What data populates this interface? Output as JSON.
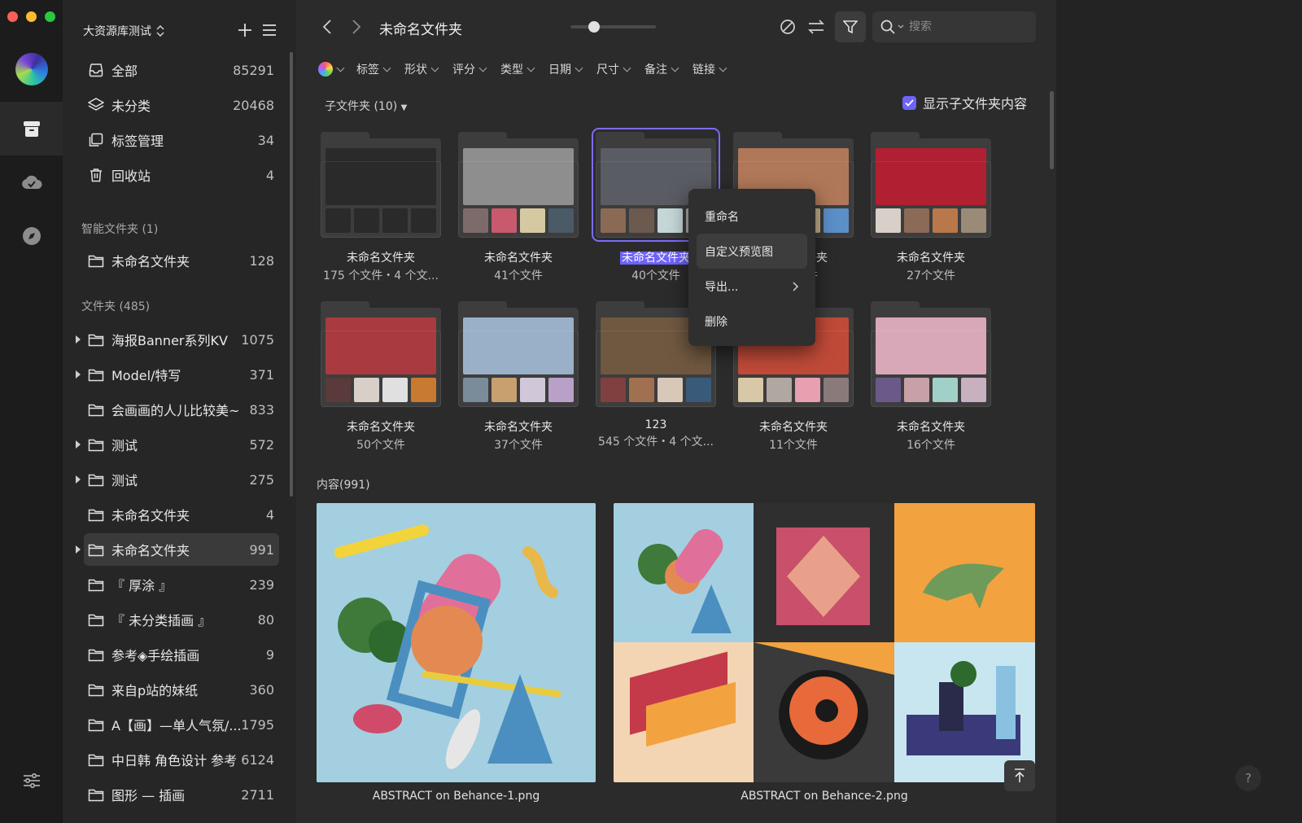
{
  "window": {
    "traffic_colors": [
      "#ff5f57",
      "#febc2e",
      "#28c840"
    ]
  },
  "library": {
    "name": "大资源库测试"
  },
  "sidebar": {
    "top_items": [
      {
        "label": "全部",
        "count": "85291",
        "icon": "inbox-icon"
      },
      {
        "label": "未分类",
        "count": "20468",
        "icon": "layers-icon"
      },
      {
        "label": "标签管理",
        "count": "34",
        "icon": "tag-manage-icon"
      },
      {
        "label": "回收站",
        "count": "4",
        "icon": "trash-icon"
      }
    ],
    "smart_title": "智能文件夹 (1)",
    "smart_items": [
      {
        "label": "未命名文件夹",
        "count": "128"
      }
    ],
    "folders_title": "文件夹 (485)",
    "folders": [
      {
        "label": "海报Banner系列KV",
        "count": "1075",
        "expandable": true
      },
      {
        "label": "Model/特写",
        "count": "371",
        "expandable": true
      },
      {
        "label": "会画画的人儿比较美~",
        "count": "833",
        "expandable": false
      },
      {
        "label": "测试",
        "count": "572",
        "expandable": true
      },
      {
        "label": "测试",
        "count": "275",
        "expandable": true
      },
      {
        "label": "未命名文件夹",
        "count": "4",
        "expandable": false
      },
      {
        "label": "未命名文件夹",
        "count": "991",
        "expandable": true,
        "selected": true
      },
      {
        "label": "『 厚涂 』",
        "count": "239",
        "expandable": false
      },
      {
        "label": "『 未分类插画 』",
        "count": "80",
        "expandable": false
      },
      {
        "label": "参考◈手绘插画",
        "count": "9",
        "expandable": false
      },
      {
        "label": "来自p站的妹纸",
        "count": "360",
        "expandable": false
      },
      {
        "label": "A【画】—单人气氛/...",
        "count": "1795",
        "expandable": false
      },
      {
        "label": "中日韩 角色设计 参考",
        "count": "6124",
        "expandable": false
      },
      {
        "label": "图形 — 插画",
        "count": "2711",
        "expandable": false
      }
    ]
  },
  "toolbar": {
    "title": "未命名文件夹",
    "zoom_percent": 28,
    "search_placeholder": "搜索"
  },
  "filters": [
    "标签",
    "形状",
    "评分",
    "类型",
    "日期",
    "尺寸",
    "备注",
    "链接"
  ],
  "subfolders": {
    "label": "子文件夹 (10)",
    "show_sub_label": "显示子文件夹内容",
    "items": [
      {
        "name": "未命名文件夹",
        "sub": "175 个文件・4 个文...",
        "main": "#2a2a2a",
        "smalls": [
          "#2a2a2a",
          "#2a2a2a",
          "#2a2a2a",
          "#2a2a2a"
        ]
      },
      {
        "name": "未命名文件夹",
        "sub": "41个文件",
        "main": "#8e8e8e",
        "smalls": [
          "#7d6a6a",
          "#c95a6e",
          "#d4c9a0",
          "#4a5a66"
        ]
      },
      {
        "name": "未命名文件夹",
        "sub": "40个文件",
        "main": "#5a5c63",
        "smalls": [
          "#8a6a55",
          "#6d5a4f",
          "#c4d6d8",
          "#b0b0b0"
        ],
        "selected": true
      },
      {
        "name": "未命名文件夹",
        "sub": "41个文件",
        "main": "#b07858",
        "smalls": [
          "#5a6c78",
          "#8b8b8b",
          "#c7b290",
          "#5b8fc8"
        ]
      },
      {
        "name": "未命名文件夹",
        "sub": "27个文件",
        "main": "#b02032",
        "smalls": [
          "#d8d0c8",
          "#8c6a58",
          "#b8784a",
          "#9c8a78"
        ]
      },
      {
        "name": "未命名文件夹",
        "sub": "50个文件",
        "main": "#a83a40",
        "smalls": [
          "#5a3a3a",
          "#d8d0c8",
          "#e0e0e0",
          "#c87a30"
        ]
      },
      {
        "name": "未命名文件夹",
        "sub": "37个文件",
        "main": "#9ab0c8",
        "smalls": [
          "#7a8c9a",
          "#c8a070",
          "#d0c8d8",
          "#b8a0c8"
        ]
      },
      {
        "name": "123",
        "sub": "545 个文件・4 个文...",
        "main": "#705840",
        "smalls": [
          "#804040",
          "#a07050",
          "#d8c8b8",
          "#3a5a7a"
        ]
      },
      {
        "name": "未命名文件夹",
        "sub": "11个文件",
        "main": "#c04a38",
        "smalls": [
          "#d8c8a8",
          "#b0a8a0",
          "#e8a0b0",
          "#8a7a7a"
        ]
      },
      {
        "name": "未命名文件夹",
        "sub": "16个文件",
        "main": "#d8a8b8",
        "smalls": [
          "#6a5a8a",
          "#c8a0a8",
          "#a0d0c8",
          "#c8b0c0"
        ]
      }
    ]
  },
  "context_menu": {
    "items": [
      "重命名",
      "自定义预览图",
      "导出...",
      "删除"
    ]
  },
  "content": {
    "label": "内容(991)",
    "images": [
      {
        "caption": "ABSTRACT on Behance-1.png"
      },
      {
        "caption": "ABSTRACT on Behance-2.png"
      }
    ]
  },
  "help": "?"
}
